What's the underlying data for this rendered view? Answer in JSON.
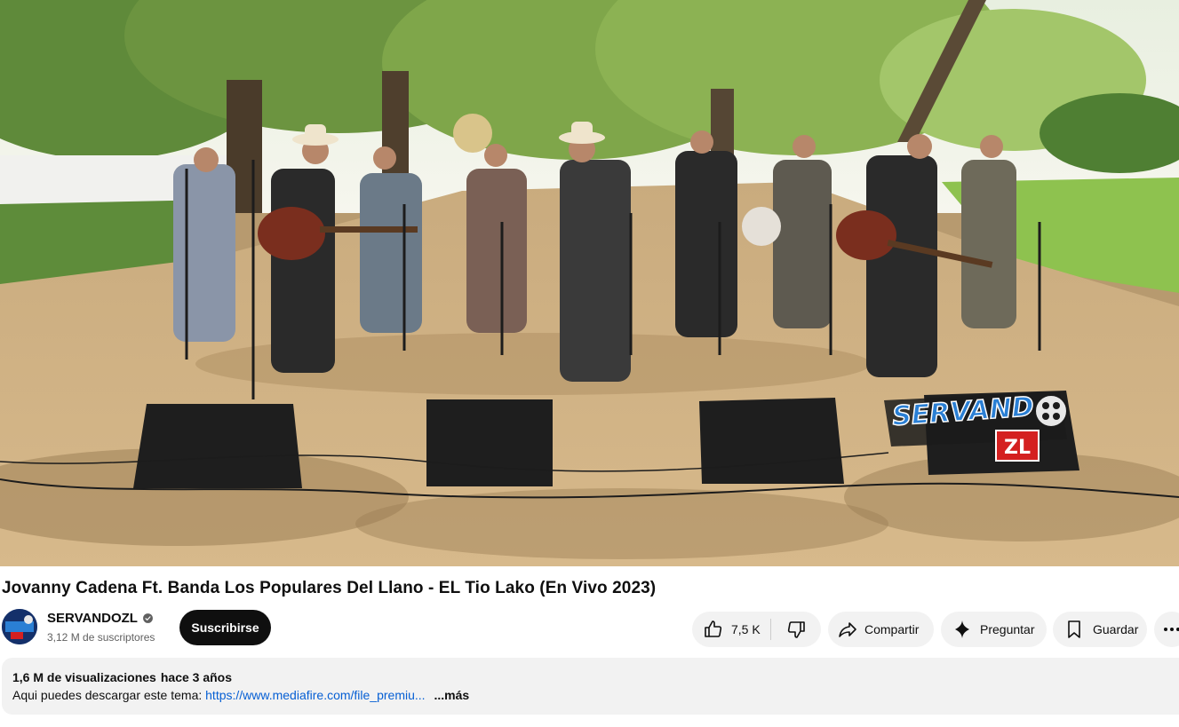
{
  "video": {
    "watermark_top": "SERVAND",
    "watermark_bottom": "ZL"
  },
  "title": "Jovanny Cadena Ft. Banda Los Populares Del Llano - EL Tio Lako (En Vivo 2023)",
  "channel": {
    "name": "SERVANDOZL",
    "subscribers": "3,12 M de suscriptores",
    "subscribe_label": "Suscribirse"
  },
  "actions": {
    "like_count": "7,5 K",
    "share_label": "Compartir",
    "ask_label": "Preguntar",
    "save_label": "Guardar"
  },
  "description": {
    "views": "1,6 M de visualizaciones",
    "age": "hace 3 años",
    "text": "Aqui puedes descargar este tema:",
    "link": "https://www.mediafire.com/file_premiu...",
    "more_label": "...más"
  },
  "colors": {
    "subscribe_bg": "#0f0f0f",
    "pill_bg": "#f2f2f2",
    "link": "#065fd4",
    "watermark_blue": "#2a7fd4",
    "watermark_red": "#d42020"
  },
  "icons": [
    "verified-icon",
    "thumb-up-icon",
    "thumb-down-icon",
    "share-icon",
    "sparkle-icon",
    "bookmark-icon",
    "more-icon"
  ]
}
